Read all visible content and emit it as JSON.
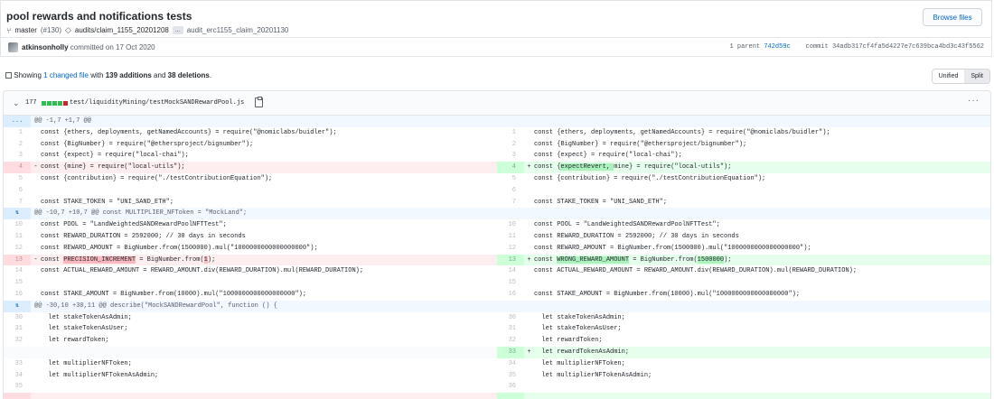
{
  "commit": {
    "title": "pool rewards and notifications tests",
    "branch": "master",
    "pr": "(#130)",
    "tag": "audits/claim_1155_20201208",
    "more_tags": "...",
    "tag2": "audit_erc1155_claim_20201130",
    "browse_label": "Browse files",
    "author": "atkinsonholly",
    "committed_text": "committed on 17 Oct 2020",
    "parent_label": "1 parent",
    "parent_sha": "742d59c",
    "commit_label": "commit",
    "commit_sha": "34adb317cf4fa5d4227e7c639bca4bd3c43f5562"
  },
  "summary": {
    "prefix": "Showing",
    "changed": "1 changed file",
    "with": "with",
    "additions": "139 additions",
    "and": "and",
    "deletions": "38 deletions",
    "suffix": ".",
    "unified": "Unified",
    "split": "Split"
  },
  "file": {
    "count": "177",
    "path": "test/liquidityMining/testMockSANDRewardPool.js",
    "more": "···"
  },
  "hunks": {
    "h1": "@@ -1,7 +1,7 @@",
    "h2": "@@ -10,7 +10,7 @@ const MULTIPLIER_NFToken = \"MockLand\";",
    "h3": "@@ -30,10 +30,11 @@ describe(\"MockSANDRewardPool\", function () {",
    "expand_dots": "...",
    "expand_icon": "⇅"
  },
  "lines": {
    "l1": "const {ethers, deployments, getNamedAccounts} = require(\"@nomiclabs/buidler\");",
    "l2": "const {BigNumber} = require(\"@ethersproject/bignumber\");",
    "l3": "const {expect} = require(\"local-chai\");",
    "l4_old": "const {mine} = require(\"local-utils\");",
    "l4_new_a": "const {",
    "l4_new_hl": "expectRevert, ",
    "l4_new_b": "mine} = require(\"local-utils\");",
    "l5": "const {contribution} = require(\"./testContributionEquation\");",
    "l7": "const STAKE_TOKEN = \"UNI_SAND_ETH\";",
    "l10": "const POOL = \"LandWeightedSANDRewardPoolNFTTest\";",
    "l11": "const REWARD_DURATION = 2592000; // 30 days in seconds",
    "l12": "const REWARD_AMOUNT = BigNumber.from(1500000).mul(\"1000000000000000000\");",
    "l13_old_a": "const ",
    "l13_old_hl1": "PRECISION_INCREMENT",
    "l13_old_b": " = BigNumber.from(",
    "l13_old_hl2": "1",
    "l13_old_c": ");",
    "l13_new_a": "const ",
    "l13_new_hl1": "WRONG_REWARD_AMOUNT",
    "l13_new_b": " = BigNumber.from(",
    "l13_new_hl2": "1500000",
    "l13_new_c": ");",
    "l14": "const ACTUAL_REWARD_AMOUNT = REWARD_AMOUNT.div(REWARD_DURATION).mul(REWARD_DURATION);",
    "l16": "const STAKE_AMOUNT = BigNumber.from(10000).mul(\"1000000000000000000\");",
    "l30": "  let stakeTokenAsAdmin;",
    "l31": "  let stakeTokenAsUser;",
    "l32": "  let rewardToken;",
    "l33_new": "  let rewardTokenAsAdmin;",
    "l33": "  let multiplierNFToken;",
    "l34": "  let multiplierNFTokenAsAdmin;"
  }
}
